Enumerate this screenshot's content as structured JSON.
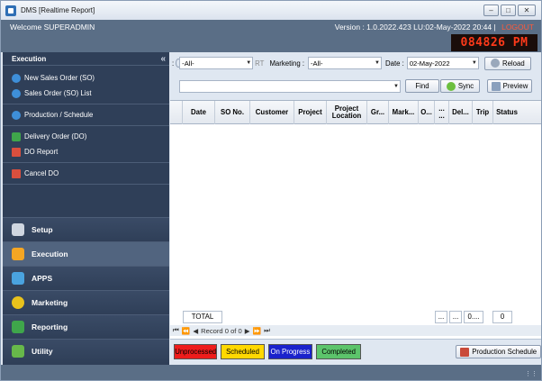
{
  "window": {
    "title": "DMS [Realtime Report]",
    "controls": [
      "minimize",
      "maximize",
      "close"
    ]
  },
  "header": {
    "welcome": "Welcome SUPERADMIN",
    "version": "Version : 1.0.2022.423 LU:02-May-2022 20:44",
    "separator": "|",
    "logout": "LOGOUT",
    "clock": "084826 PM"
  },
  "sidebar": {
    "title": "Execution",
    "collapse_icon": "«",
    "items": [
      {
        "label": "New Sales Order (SO)",
        "icon": "new-order-icon"
      },
      {
        "label": "Sales Order (SO) List",
        "icon": "order-list-icon"
      },
      {
        "label": "Production / Schedule",
        "icon": "production-icon"
      },
      {
        "label": "Delivery Order (DO)",
        "icon": "delivery-icon"
      },
      {
        "label": "DO Report",
        "icon": "report-icon"
      },
      {
        "label": "Cancel DO",
        "icon": "cancel-icon"
      }
    ],
    "modules": [
      {
        "label": "Setup",
        "icon": "tools-icon",
        "color": "#cfd6e0"
      },
      {
        "label": "Execution",
        "icon": "execution-icon",
        "color": "#f5a623"
      },
      {
        "label": "APPS",
        "icon": "monitor-icon",
        "color": "#4aa3df"
      },
      {
        "label": "Marketing",
        "icon": "coins-icon",
        "color": "#e8c21c"
      },
      {
        "label": "Reporting",
        "icon": "chart-icon",
        "color": "#3fa64b"
      },
      {
        "label": "Utility",
        "icon": "utility-icon",
        "color": "#67b84a"
      }
    ]
  },
  "filters": {
    "plant_suffix": ":",
    "plant_value": "-All-",
    "rt_label": "RT",
    "marketing_label": "Marketing :",
    "marketing_value": "-All-",
    "date_label": "Date :",
    "date_value": "02-May-2022",
    "reload": "Reload",
    "search_value": "",
    "find": "Find",
    "sync": "Sync",
    "preview": "Preview"
  },
  "grid": {
    "columns": [
      "Date",
      "SO No.",
      "Customer",
      "Project",
      "Project\nLocation",
      "Gr...",
      "Mark...",
      "O...",
      "...\n...",
      "Del...",
      "Trip",
      "Status"
    ],
    "rows": []
  },
  "totals": {
    "label": "TOTAL",
    "c1": "...",
    "c2": "...",
    "c3": "0....",
    "c4": "0"
  },
  "navigator": {
    "record_text": "Record 0 of 0"
  },
  "status_legend": [
    {
      "label": "Unprocessed",
      "color": "#ee1c1c"
    },
    {
      "label": "Scheduled",
      "color": "#ffd800"
    },
    {
      "label": "On Progress",
      "color": "#1a22cc"
    },
    {
      "label": "Completed",
      "color": "#5cc46b"
    }
  ],
  "production_schedule": "Production Schedule"
}
